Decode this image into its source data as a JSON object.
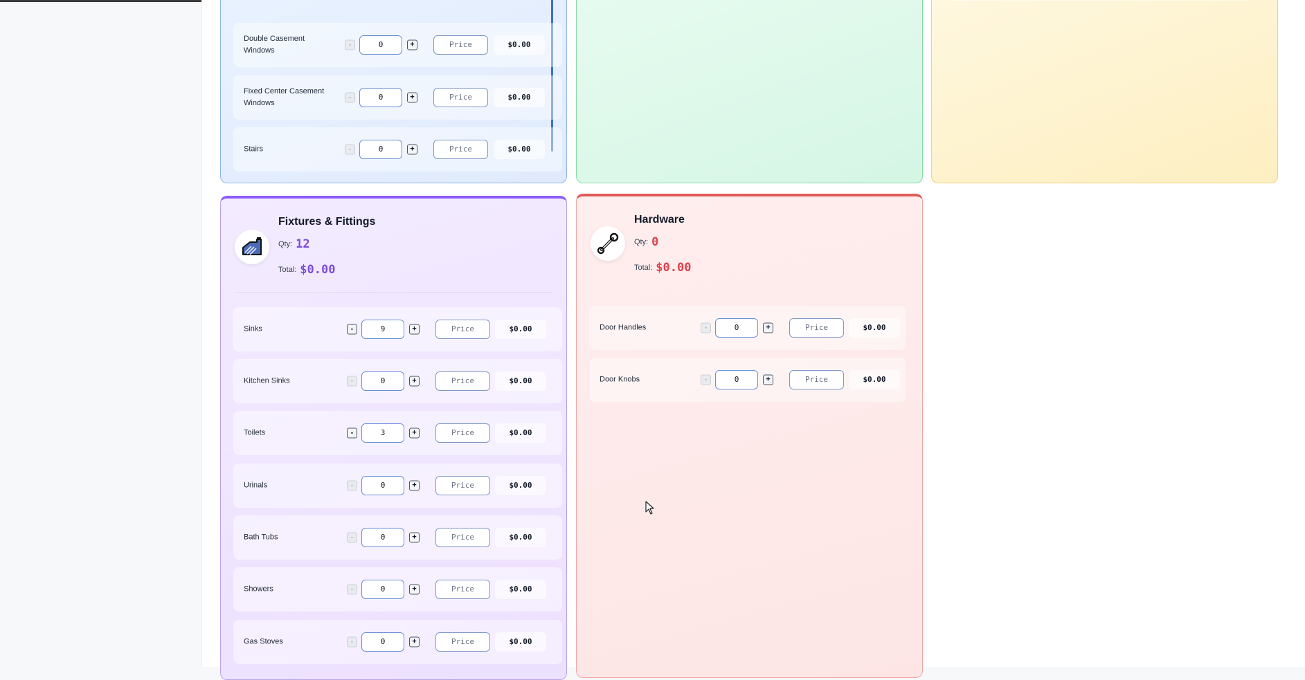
{
  "blue_card": {
    "rows": [
      {
        "label": "Double Casement Windows",
        "qty": "0",
        "price_placeholder": "Price",
        "amount": "$0.00"
      },
      {
        "label": "Fixed Center Casement Windows",
        "qty": "0",
        "price_placeholder": "Price",
        "amount": "$0.00"
      },
      {
        "label": "Stairs",
        "qty": "0",
        "price_placeholder": "Price",
        "amount": "$0.00"
      }
    ]
  },
  "fixtures": {
    "title": "Fixtures & Fittings",
    "icon": "faucet-icon",
    "qty_label": "Qty:",
    "qty_value": "12",
    "total_label": "Total:",
    "total_value": "$0.00",
    "accent": "#8b5cf6",
    "rows": [
      {
        "label": "Sinks",
        "qty": "9",
        "price_placeholder": "Price",
        "amount": "$0.00"
      },
      {
        "label": "Kitchen Sinks",
        "qty": "0",
        "price_placeholder": "Price",
        "amount": "$0.00"
      },
      {
        "label": "Toilets",
        "qty": "3",
        "price_placeholder": "Price",
        "amount": "$0.00"
      },
      {
        "label": "Urinals",
        "qty": "0",
        "price_placeholder": "Price",
        "amount": "$0.00"
      },
      {
        "label": "Bath Tubs",
        "qty": "0",
        "price_placeholder": "Price",
        "amount": "$0.00"
      },
      {
        "label": "Showers",
        "qty": "0",
        "price_placeholder": "Price",
        "amount": "$0.00"
      },
      {
        "label": "Gas Stoves",
        "qty": "0",
        "price_placeholder": "Price",
        "amount": "$0.00"
      }
    ]
  },
  "hardware": {
    "title": "Hardware",
    "icon": "wrench-icon",
    "qty_label": "Qty:",
    "qty_value": "0",
    "total_label": "Total:",
    "total_value": "$0.00",
    "accent": "#e05a5a",
    "rows": [
      {
        "label": "Door Handles",
        "qty": "0",
        "price_placeholder": "Price",
        "amount": "$0.00"
      },
      {
        "label": "Door Knobs",
        "qty": "0",
        "price_placeholder": "Price",
        "amount": "$0.00"
      }
    ]
  },
  "stepper": {
    "minus": "-",
    "plus": "+"
  }
}
